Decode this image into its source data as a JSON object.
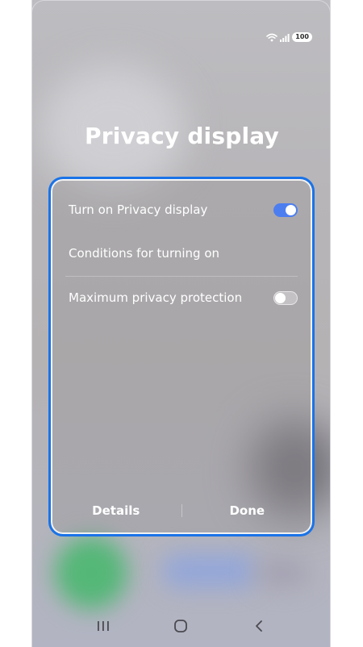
{
  "status_bar": {
    "battery": "100",
    "icons": [
      "wifi-icon",
      "signal-icon"
    ]
  },
  "dialog": {
    "title": "Privacy display",
    "options": [
      {
        "label": "Turn on Privacy display",
        "toggle": "on"
      },
      {
        "label": "Conditions for turning on"
      },
      {
        "label": "Maximum privacy protection",
        "toggle": "off"
      }
    ],
    "buttons": {
      "details": "Details",
      "done": "Done"
    },
    "highlight_color": "#1a73e8",
    "toggle_on_color": "#4d7ef0"
  },
  "nav_bar": {
    "icons": [
      "recents-icon",
      "home-icon",
      "back-icon"
    ]
  }
}
